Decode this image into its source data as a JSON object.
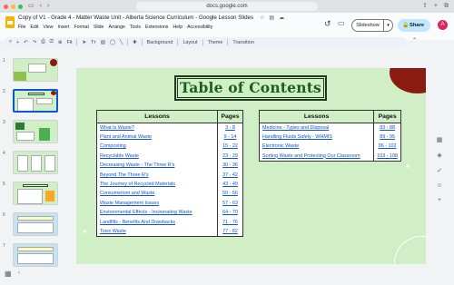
{
  "browser": {
    "url": "docs.google.com",
    "dot_colors": [
      "#ff5f57",
      "#febc2e",
      "#28c840"
    ]
  },
  "doc": {
    "title": "Copy of V1 - Grade 4 - Matter Waste Unit - Alberta Science Curriculum - Google Lesson Slides",
    "menu": [
      "File",
      "Edit",
      "View",
      "Insert",
      "Format",
      "Slide",
      "Arrange",
      "Tools",
      "Extensions",
      "Help",
      "Accessibility"
    ],
    "slideshow_label": "Slideshow",
    "share_label": "Share",
    "avatar_initial": "A"
  },
  "toolbar": {
    "zoom_label": "Fit",
    "background_label": "Background",
    "layout_label": "Layout",
    "theme_label": "Theme",
    "transition_label": "Transition"
  },
  "filmstrip": {
    "numbers": [
      "1",
      "2",
      "3",
      "4",
      "5",
      "6",
      "7"
    ],
    "selected": 2
  },
  "slide": {
    "title": "Table of Contents",
    "colors": {
      "background": "#d0efc6",
      "title": "#1b5e20",
      "link": "#1155cc",
      "accent": "#8b1a10"
    },
    "left_table": {
      "headers": [
        "Lessons",
        "Pages"
      ],
      "rows": [
        [
          "What Is Waste?",
          "3 - 8"
        ],
        [
          "Plant and Animal Waste",
          "9 - 14"
        ],
        [
          "Composting",
          "15 - 22"
        ],
        [
          "Recyclable Waste",
          "23 - 29"
        ],
        [
          "Decreasing Waste - The Three R's",
          "30 - 36"
        ],
        [
          "Beyond The Three R's",
          "37 - 42"
        ],
        [
          "The Journey of Recycled Materials",
          "43 - 49"
        ],
        [
          "Consumerism and Waste",
          "50 - 56"
        ],
        [
          "Waste Management Issues",
          "57 - 63"
        ],
        [
          "Environmental Effects - Incinerating Waste",
          "64 - 70"
        ],
        [
          "Landfills - Benefits And Drawbacks",
          "71 - 76"
        ],
        [
          "Toxic Waste",
          "77 - 82"
        ]
      ]
    },
    "right_table": {
      "headers": [
        "Lessons",
        "Pages"
      ],
      "rows": [
        [
          "Medicine - Types and Disposal",
          "83 - 88"
        ],
        [
          "Handling Fluids Safely - WHMIS",
          "89 - 95"
        ],
        [
          "Electronic Waste",
          "96 - 102"
        ],
        [
          "Sorting Waste and Protecting Our Classroom",
          "103 - 108"
        ]
      ]
    }
  }
}
